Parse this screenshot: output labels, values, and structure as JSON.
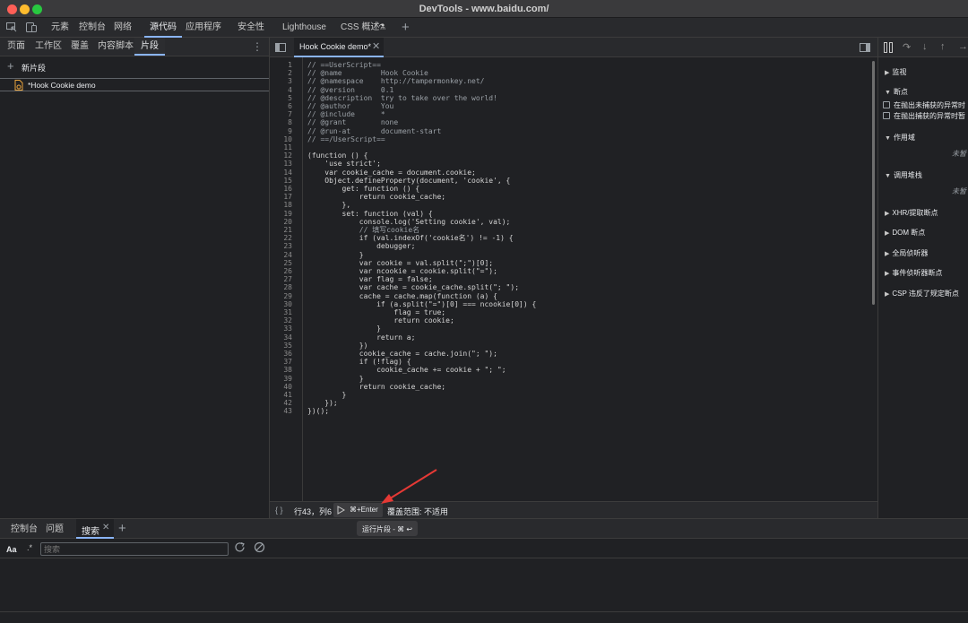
{
  "window": {
    "title": "DevTools - www.baidu.com/"
  },
  "main_tabs": [
    "元素",
    "控制台",
    "网络",
    "源代码",
    "应用程序",
    "安全性",
    "Lighthouse",
    "CSS 概述"
  ],
  "main_tabs_active": "源代码",
  "sources": {
    "tabs": [
      "页面",
      "工作区",
      "覆盖",
      "内容脚本",
      "片段"
    ],
    "active_tab": "片段",
    "new_snippet_label": "新片段",
    "snippet_name": "*Hook Cookie demo"
  },
  "editor": {
    "tab_label": "Hook Cookie demo*",
    "code_lines": [
      "// ==UserScript==",
      "// @name         Hook Cookie",
      "// @namespace    http://tampermonkey.net/",
      "// @version      0.1",
      "// @description  try to take over the world!",
      "// @author       You",
      "// @include      *",
      "// @grant        none",
      "// @run-at       document-start",
      "// ==/UserScript==",
      "",
      "(function () {",
      "    'use strict';",
      "    var cookie_cache = document.cookie;",
      "    Object.defineProperty(document, 'cookie', {",
      "        get: function () {",
      "            return cookie_cache;",
      "        },",
      "        set: function (val) {",
      "            console.log('Setting cookie', val);",
      "            // 填写cookie名",
      "            if (val.indexOf('cookie名') != -1) {",
      "                debugger;",
      "            }",
      "            var cookie = val.split(\";\")[0];",
      "            var ncookie = cookie.split(\"=\");",
      "            var flag = false;",
      "            var cache = cookie_cache.split(\"; \");",
      "            cache = cache.map(function (a) {",
      "                if (a.split(\"=\")[0] === ncookie[0]) {",
      "                    flag = true;",
      "                    return cookie;",
      "                }",
      "                return a;",
      "            })",
      "            cookie_cache = cache.join(\"; \");",
      "            if (!flag) {",
      "                cookie_cache += cookie + \"; \";",
      "            }",
      "            return cookie_cache;",
      "        }",
      "    });",
      "})();"
    ],
    "status": {
      "braces": "{ }",
      "position": "行43，列6",
      "run_shortcut": "⌘+Enter",
      "coverage": "覆盖范围: 不适用"
    },
    "tooltip": "运行片段 - ⌘ ↩"
  },
  "debugger_pane": {
    "sections": [
      {
        "label": "监视",
        "expanded": false
      },
      {
        "label": "断点",
        "expanded": true
      },
      {
        "label": "作用域",
        "expanded": true
      },
      {
        "label": "调用堆栈",
        "expanded": true
      },
      {
        "label": "XHR/提取断点",
        "expanded": false
      },
      {
        "label": "DOM 断点",
        "expanded": false
      },
      {
        "label": "全局侦听器",
        "expanded": false
      },
      {
        "label": "事件侦听器断点",
        "expanded": false
      },
      {
        "label": "CSP 违反了规定断点",
        "expanded": false
      }
    ],
    "checkbox_uncaught": "在抛出未捕获的异常时",
    "checkbox_caught": "在抛出捕获的异常时暂",
    "scope_placeholder": "未暂",
    "callstack_placeholder": "未暂"
  },
  "drawer": {
    "tabs": [
      "控制台",
      "问题",
      "搜索"
    ],
    "active_tab": "搜索",
    "match_case_label": "Aa",
    "regex_label": ".*",
    "search_placeholder": "搜索"
  },
  "colors": {
    "background": "#202124",
    "accent": "#8ab4f8",
    "traffic_red": "#ff5f57",
    "traffic_yellow": "#febc2e",
    "traffic_green": "#28c840",
    "annotation_arrow": "#e53935"
  }
}
